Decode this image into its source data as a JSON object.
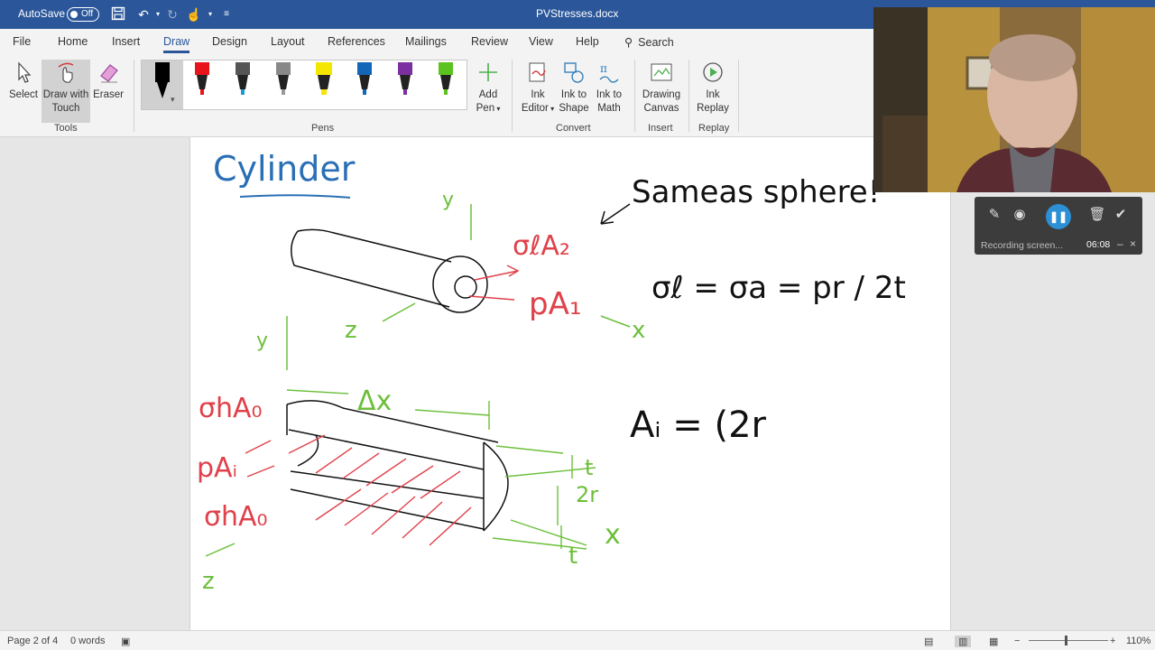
{
  "titlebar": {
    "autosave_label": "AutoSave",
    "autosave_state": "Off",
    "document_title": "PVStresses.docx"
  },
  "tabs": {
    "file": "File",
    "home": "Home",
    "insert": "Insert",
    "draw": "Draw",
    "design": "Design",
    "layout": "Layout",
    "references": "References",
    "mailings": "Mailings",
    "review": "Review",
    "view": "View",
    "help": "Help",
    "search": "Search"
  },
  "ribbon": {
    "select": "Select",
    "draw_with_touch_1": "Draw with",
    "draw_with_touch_2": "Touch",
    "eraser": "Eraser",
    "tools_group": "Tools",
    "pens_group": "Pens",
    "add_pen_1": "Add",
    "add_pen_2": "Pen",
    "ink_editor_1": "Ink",
    "ink_editor_2": "Editor",
    "ink_to_shape_1": "Ink to",
    "ink_to_shape_2": "Shape",
    "ink_to_math_1": "Ink to",
    "ink_to_math_2": "Math",
    "convert_group": "Convert",
    "drawing_canvas_1": "Drawing",
    "drawing_canvas_2": "Canvas",
    "insert_group": "Insert",
    "ink_replay_1": "Ink",
    "ink_replay_2": "Replay",
    "replay_group": "Replay",
    "pen_colors": [
      "#000000",
      "#e8141c",
      "#1a9bd6",
      "#9a9a9a",
      "#f5e600",
      "#1466b8",
      "#7b2fa0",
      "#5cc21f"
    ]
  },
  "recording": {
    "status": "Recording screen...",
    "time": "06:08"
  },
  "statusbar": {
    "page": "Page 2 of 4",
    "words": "0 words",
    "zoom": "110%"
  },
  "ink_text": {
    "title": "Cylinder",
    "same_as_sphere": "Sameas sphere!",
    "sigma_l_a2": "σℓA₂",
    "p_a1": "pA₁",
    "formula": "σℓ = σa = pr / 2t",
    "z_upper": "z",
    "x_upper": "x",
    "sigma_h_a0": "σhA₀",
    "delta_x": "Δx",
    "p_ai": "pAᵢ",
    "sigma_h_a0_lower": "σhA₀",
    "t_label": "t",
    "two_r": "2r",
    "x_lower": "x",
    "t_lower": "t",
    "z_lower": "z",
    "y_upper": "y",
    "y_lower": "y",
    "ai_formula": "Aᵢ = (2r"
  },
  "colors": {
    "accent": "#2b579a",
    "ink_blue": "#2a6fb5",
    "ink_red": "#e0414a",
    "ink_green": "#6cbf3a",
    "ink_black": "#111111"
  }
}
